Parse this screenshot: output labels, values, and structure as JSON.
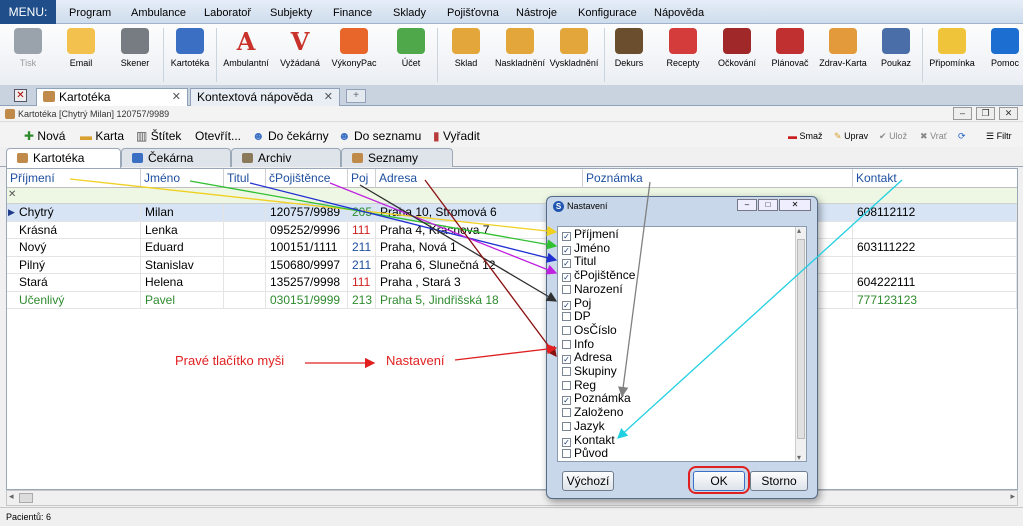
{
  "menubar": {
    "label": "MENU:",
    "items": [
      "Program",
      "Ambulance",
      "Laboratoř",
      "Subjekty",
      "Finance",
      "Sklady",
      "Pojišťovna",
      "Nástroje",
      "Konfigurace",
      "Nápověda"
    ]
  },
  "toolbar": {
    "items": [
      {
        "label": "Tisk",
        "icon": "printer-icon",
        "color": "#9aa2ab"
      },
      {
        "label": "Email",
        "icon": "envelope-icon",
        "color": "#f2c14e"
      },
      {
        "label": "Skener",
        "icon": "scanner-icon",
        "color": "#777c83"
      },
      {
        "label": "Kartotéka",
        "icon": "people-icon",
        "color": "#3a6fc4"
      },
      {
        "label": "Ambulantní",
        "icon": "letter-a-icon",
        "color": "#c8322a",
        "glyph": "A"
      },
      {
        "label": "Vyžádaná",
        "icon": "letter-v-icon",
        "color": "#c8322a",
        "glyph": "V"
      },
      {
        "label": "VýkonyPac",
        "icon": "bar-chart-icon",
        "color": "#e8662a"
      },
      {
        "label": "Účet",
        "icon": "money-icon",
        "color": "#4fa84a"
      },
      {
        "label": "Sklad",
        "icon": "box-icon",
        "color": "#e3a63a"
      },
      {
        "label": "Naskladnění",
        "icon": "box-add-icon",
        "color": "#e3a63a"
      },
      {
        "label": "Vyskladnění",
        "icon": "box-remove-icon",
        "color": "#e3a63a"
      },
      {
        "label": "Dekurs",
        "icon": "doctor-case-icon",
        "color": "#6b4e2e"
      },
      {
        "label": "Recepty",
        "icon": "pills-icon",
        "color": "#d43c3c"
      },
      {
        "label": "Očkování",
        "icon": "syringe-icon",
        "color": "#a02828"
      },
      {
        "label": "Plánovač",
        "icon": "calendar-icon",
        "color": "#c03030"
      },
      {
        "label": "Zdrav-Karta",
        "icon": "health-card-icon",
        "color": "#e39a3a"
      },
      {
        "label": "Poukaz",
        "icon": "voucher-icon",
        "color": "#4a6fa8"
      },
      {
        "label": "Připomínka",
        "icon": "lightbulb-icon",
        "color": "#f0c43a"
      },
      {
        "label": "Pomoc",
        "icon": "teamviewer-icon",
        "color": "#1c6fd1"
      }
    ]
  },
  "tabs": {
    "items": [
      "Kartotéka",
      "Kontextová nápověda"
    ]
  },
  "window": {
    "title": "Kartotéka [Chytrý Milan] 120757/9989"
  },
  "actions": {
    "left": [
      "Nová",
      "Karta",
      "Štítek",
      "Otevřít...",
      "Do čekárny",
      "Do seznamu",
      "Vyřadit"
    ],
    "right": [
      "Smaž",
      "Uprav",
      "Ulož",
      "Vrať",
      "Filtr"
    ]
  },
  "subtabs": [
    "Kartotéka",
    "Čekárna",
    "Archiv",
    "Seznamy"
  ],
  "grid": {
    "columns": [
      "Příjmení",
      "Jméno",
      "Titul",
      "čPojištěnce",
      "Poj",
      "Adresa",
      "Poznámka",
      "Kontakt"
    ],
    "rows": [
      {
        "cells": [
          "Chytrý",
          "Milan",
          "",
          "120757/9989",
          "205",
          "Praha 10, Stromová 6",
          "",
          "608112112"
        ],
        "color": "#000000",
        "selected": true
      },
      {
        "cells": [
          "Krásná",
          "Lenka",
          "",
          "095252/9996",
          "111",
          "Praha 4, Krásnova 7",
          "",
          ""
        ],
        "color": "#000000",
        "selected": false
      },
      {
        "cells": [
          "Nový",
          "Eduard",
          "",
          "100151/1111",
          "211",
          "Praha, Nová 1",
          "",
          "603111222"
        ],
        "color": "#000000",
        "selected": false
      },
      {
        "cells": [
          "Pilný",
          "Stanislav",
          "",
          "150680/9997",
          "211",
          "Praha 6, Slunečná 12",
          "",
          ""
        ],
        "color": "#000000",
        "selected": false
      },
      {
        "cells": [
          "Stará",
          "Helena",
          "",
          "135257/9998",
          "111",
          "Praha , Stará 3",
          "",
          "604222111"
        ],
        "color": "#000000",
        "selected": false
      },
      {
        "cells": [
          "Učenlivý",
          "Pavel",
          "",
          "030151/9999",
          "213",
          "Praha 5, Jindřišská 18",
          "",
          "777123123"
        ],
        "color": "#2e8b2e",
        "selected": false
      }
    ]
  },
  "poj_colors": {
    "205": "#2e8b2e",
    "111": "#d02020",
    "211": "#1e4fa0",
    "213": "#2e8b2e"
  },
  "dialog": {
    "title": "Nastavení",
    "items": [
      {
        "label": "Příjmení",
        "checked": true
      },
      {
        "label": "Jméno",
        "checked": true
      },
      {
        "label": "Titul",
        "checked": true
      },
      {
        "label": "čPojištěnce",
        "checked": true
      },
      {
        "label": "Narození",
        "checked": false
      },
      {
        "label": "Poj",
        "checked": true
      },
      {
        "label": "DP",
        "checked": false
      },
      {
        "label": "OsČíslo",
        "checked": false
      },
      {
        "label": "Info",
        "checked": false
      },
      {
        "label": "Adresa",
        "checked": true
      },
      {
        "label": "Skupiny",
        "checked": false
      },
      {
        "label": "Reg",
        "checked": false
      },
      {
        "label": "Poznámka",
        "checked": true
      },
      {
        "label": "Založeno",
        "checked": false
      },
      {
        "label": "Jazyk",
        "checked": false
      },
      {
        "label": "Kontakt",
        "checked": true
      },
      {
        "label": "Původ",
        "checked": false
      }
    ],
    "btn_default": "Výchozí",
    "btn_ok": "OK",
    "btn_cancel": "Storno"
  },
  "annotation": {
    "left": "Pravé tlačítko myši",
    "right": "Nastavení"
  },
  "status": {
    "text": "Pacientů: 6"
  }
}
